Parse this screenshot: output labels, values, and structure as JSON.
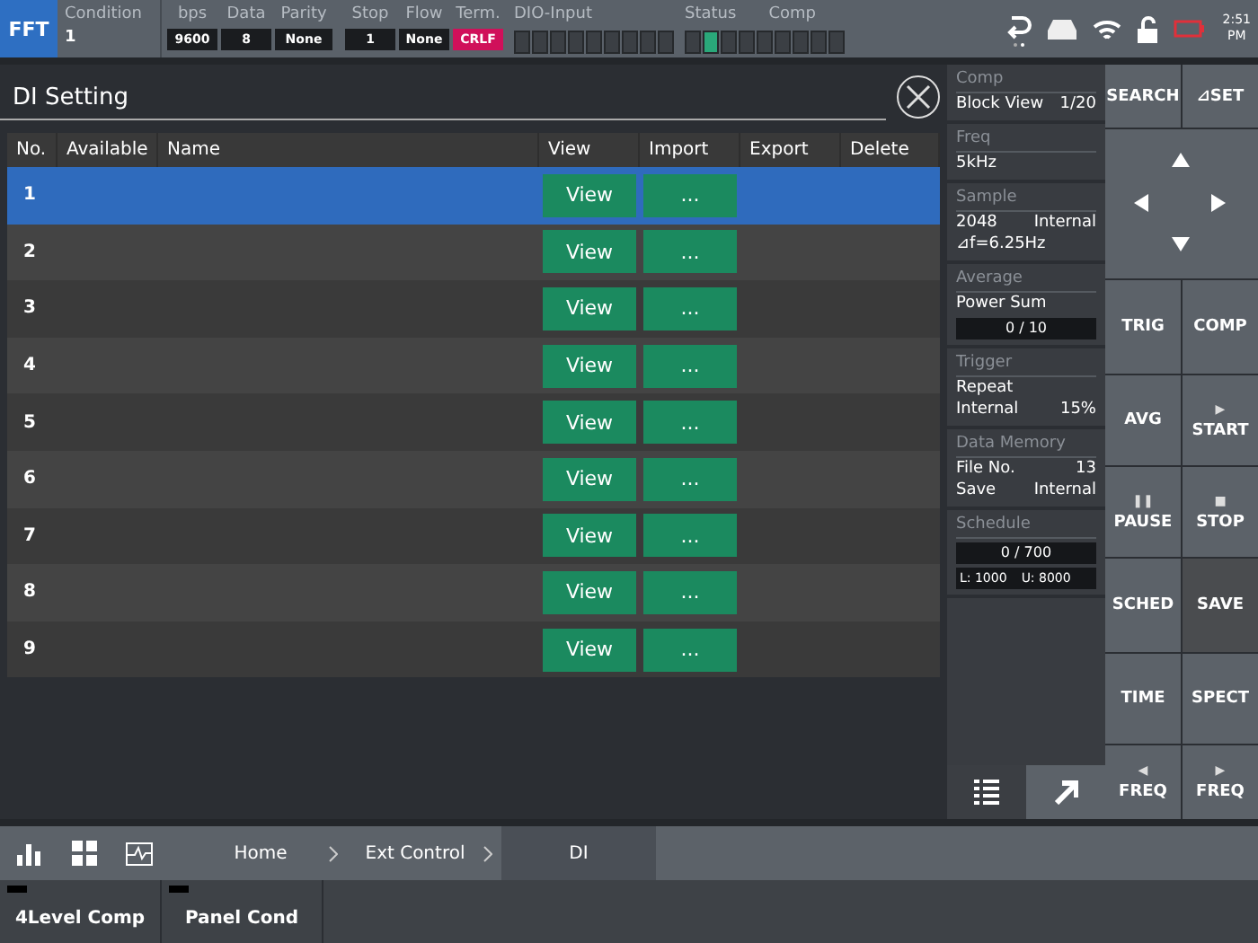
{
  "mode": "FFT",
  "condition": {
    "label": "Condition",
    "value": "1"
  },
  "comm_settings": [
    {
      "label": "bps",
      "value": "9600",
      "alert": false
    },
    {
      "label": "Data",
      "value": "8",
      "alert": false
    },
    {
      "label": "Parity",
      "value": "None",
      "alert": false
    },
    {
      "label": "Stop",
      "value": "1",
      "alert": false
    },
    {
      "label": "Flow",
      "value": "None",
      "alert": false
    },
    {
      "label": "Term.",
      "value": "CRLF",
      "alert": true
    }
  ],
  "dio_input": {
    "label": "DIO-Input",
    "leds": [
      false,
      false,
      false,
      false,
      false,
      false,
      false,
      false,
      false
    ]
  },
  "status": {
    "label": "Status",
    "comp_label": "Comp",
    "leds": [
      false,
      true,
      false,
      false,
      false,
      false,
      false,
      false,
      false
    ]
  },
  "clock": [
    "2:51",
    "PM"
  ],
  "dialog": {
    "title": "DI Setting",
    "columns": [
      "No.",
      "Available",
      "Name",
      "View",
      "Import",
      "Export",
      "Delete"
    ],
    "rows": [
      {
        "no": "1",
        "view": "View",
        "import": "...",
        "selected": true
      },
      {
        "no": "2",
        "view": "View",
        "import": "...",
        "selected": false
      },
      {
        "no": "3",
        "view": "View",
        "import": "...",
        "selected": false
      },
      {
        "no": "4",
        "view": "View",
        "import": "...",
        "selected": false
      },
      {
        "no": "5",
        "view": "View",
        "import": "...",
        "selected": false
      },
      {
        "no": "6",
        "view": "View",
        "import": "...",
        "selected": false
      },
      {
        "no": "7",
        "view": "View",
        "import": "...",
        "selected": false
      },
      {
        "no": "8",
        "view": "View",
        "import": "...",
        "selected": false
      },
      {
        "no": "9",
        "view": "View",
        "import": "...",
        "selected": false
      }
    ]
  },
  "info_panels": [
    {
      "title": "Comp",
      "lines": [
        [
          "Block View",
          "1/20"
        ]
      ]
    },
    {
      "title": "Freq",
      "lines": [
        [
          "5kHz"
        ]
      ]
    },
    {
      "title": "Sample",
      "lines": [
        [
          "2048",
          "Internal"
        ],
        [
          "⊿f=6.25Hz"
        ]
      ]
    },
    {
      "title": "Average",
      "lines": [
        [
          "Power Sum"
        ]
      ],
      "meters": [
        "0 / 10"
      ]
    },
    {
      "title": "Trigger",
      "lines": [
        [
          "Repeat"
        ],
        [
          "Internal",
          "15%"
        ]
      ]
    },
    {
      "title": "Data Memory",
      "lines": [
        [
          "File No.",
          "13"
        ],
        [
          "Save",
          "Internal"
        ]
      ]
    },
    {
      "title": "Schedule",
      "meters": [
        "0 / 700"
      ],
      "limits": [
        "L: 1000",
        "U: 8000"
      ]
    }
  ],
  "keys": [
    {
      "kind": "text",
      "label": "SEARCH",
      "selected": false
    },
    {
      "kind": "text",
      "label": "⊿SET",
      "selected": false
    },
    {
      "kind": "dpad"
    },
    {
      "kind": "text",
      "label": "TRIG",
      "selected": false
    },
    {
      "kind": "text",
      "label": "COMP",
      "selected": false
    },
    {
      "kind": "text",
      "label": "AVG",
      "selected": false
    },
    {
      "kind": "glyph",
      "glyph": "▶",
      "label": "START",
      "selected": false
    },
    {
      "kind": "glyph",
      "glyph": "❚❚",
      "label": "PAUSE",
      "selected": false
    },
    {
      "kind": "glyph",
      "glyph": "■",
      "label": "STOP",
      "selected": false
    },
    {
      "kind": "text",
      "label": "SCHED",
      "selected": false
    },
    {
      "kind": "text",
      "label": "SAVE",
      "selected": true
    },
    {
      "kind": "text",
      "label": "TIME",
      "selected": false
    },
    {
      "kind": "text",
      "label": "SPECT",
      "selected": false
    },
    {
      "kind": "glyph",
      "glyph": "◀",
      "label": "FREQ",
      "selected": false
    },
    {
      "kind": "glyph",
      "glyph": "▶",
      "label": "FREQ",
      "selected": false
    }
  ],
  "breadcrumbs": [
    {
      "label": "Home",
      "selected": false
    },
    {
      "label": "Ext Control",
      "selected": false
    },
    {
      "label": "DI",
      "selected": true
    }
  ],
  "softkeys": [
    "4Level Comp",
    "Panel Cond"
  ]
}
